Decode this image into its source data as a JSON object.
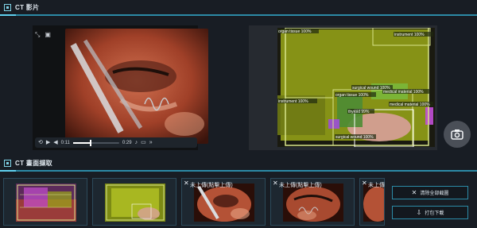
{
  "sections": {
    "video_title": "CT 影片",
    "capture_title": "CT 畫面擷取"
  },
  "player": {
    "current_time": "0:11",
    "duration": "0:29",
    "progress": 0.38
  },
  "segmentation_labels": [
    "organ tissue 100%",
    "instrument 100%",
    "surgical wound 100%",
    "instrument 100%",
    "organ tissue 100%",
    "thyroid 99%",
    "medical material 100%",
    "medical material 100%",
    "surgical wound 100%"
  ],
  "thumbnails": [
    {
      "caption": "",
      "closable": false,
      "kind": "segmented-a"
    },
    {
      "caption": "",
      "closable": false,
      "kind": "segmented-b"
    },
    {
      "caption": "未上傳(點擊上傳)",
      "closable": true,
      "kind": "raw"
    },
    {
      "caption": "未上傳(點擊上傳)",
      "closable": true,
      "kind": "raw"
    },
    {
      "caption": "未上傳",
      "closable": true,
      "kind": "raw"
    }
  ],
  "actions": {
    "clear_all": "清除全部截圖",
    "download": "打包下載"
  },
  "colors": {
    "accent": "#2c8aa6",
    "background": "#181d24",
    "segmentation": "#b8d42a"
  }
}
